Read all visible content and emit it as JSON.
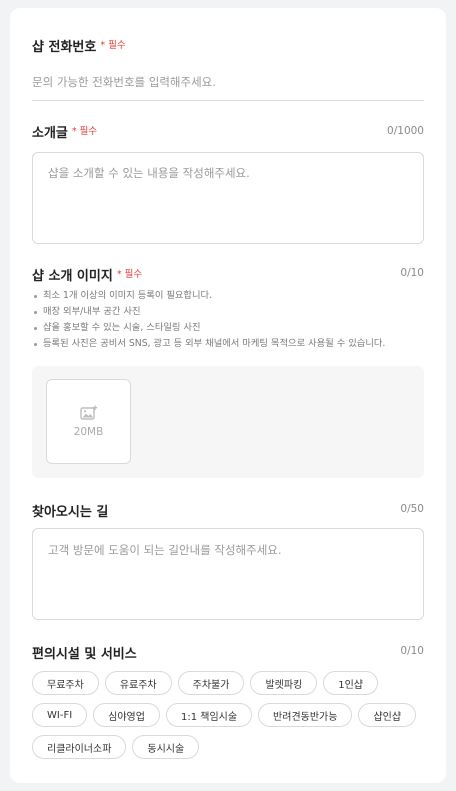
{
  "required_label": "* 필수",
  "phone": {
    "label": "샵 전화번호",
    "placeholder": "문의 가능한 전화번호를 입력해주세요."
  },
  "intro": {
    "label": "소개글",
    "counter": "0/1000",
    "placeholder": "샵을 소개할 수 있는 내용을 작성해주세요."
  },
  "images": {
    "label": "샵 소개 이미지",
    "counter": "0/10",
    "guidelines": [
      "최소 1개 이상의 이미지 등록이 필요합니다.",
      "매장 외부/내부 공간 사진",
      "샵을 홍보할 수 있는 시술, 스타일링 사진",
      "등록된 사진은 공비서 SNS, 광고 등 외부 채널에서 마케팅 목적으로 사용될 수 있습니다."
    ],
    "upload_size": "20MB",
    "upload_icon": "image-add-icon"
  },
  "directions": {
    "label": "찾아오시는 길",
    "counter": "0/50",
    "placeholder": "고객 방문에 도움이 되는 길안내를 작성해주세요."
  },
  "facilities": {
    "label": "편의시설 및 서비스",
    "counter": "0/10",
    "options": [
      "무료주차",
      "유료주차",
      "주차불가",
      "발렛파킹",
      "1인샵",
      "WI-FI",
      "심야영업",
      "1:1 책임시술",
      "반려견동반가능",
      "샵인샵",
      "리클라이너소파",
      "동시시술"
    ]
  }
}
